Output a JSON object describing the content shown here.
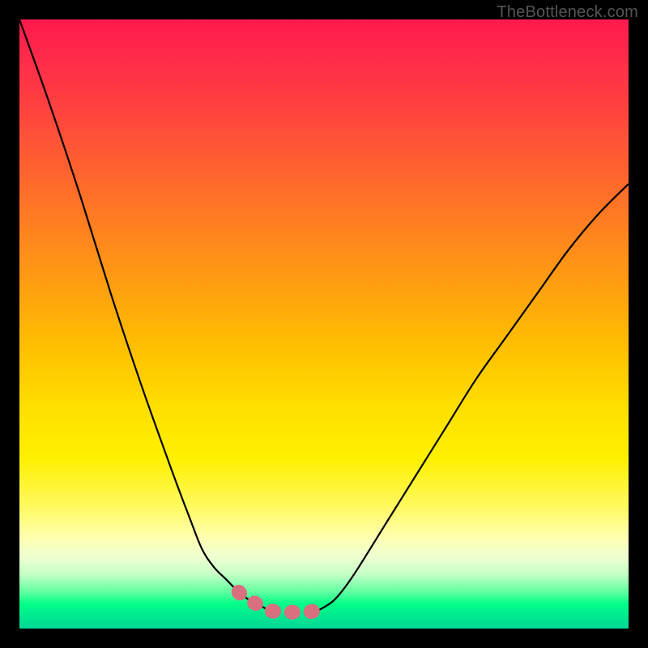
{
  "watermark": "TheBottleneck.com",
  "chart_data": {
    "type": "line",
    "title": "",
    "xlabel": "",
    "ylabel": "",
    "xlim": [
      0,
      100
    ],
    "ylim": [
      0,
      100
    ],
    "series": [
      {
        "name": "left-curve",
        "x": [
          0,
          5,
          10,
          15,
          20,
          25,
          28,
          30,
          32,
          34,
          36,
          38,
          40,
          41,
          42
        ],
        "y": [
          100,
          86,
          71,
          55,
          40,
          26,
          18,
          13,
          10,
          8,
          6,
          4.5,
          3.5,
          3,
          2.8
        ]
      },
      {
        "name": "right-curve",
        "x": [
          48,
          49,
          50,
          52,
          55,
          60,
          65,
          70,
          75,
          80,
          85,
          90,
          95,
          100
        ],
        "y": [
          2.8,
          3,
          3.5,
          5,
          9,
          17,
          25,
          33,
          41,
          48,
          55,
          62,
          68,
          73
        ]
      },
      {
        "name": "valley-marker",
        "x": [
          36,
          37,
          38,
          39,
          40,
          41,
          42,
          43,
          44,
          45,
          46,
          47,
          48,
          49,
          50
        ],
        "y": [
          6,
          5,
          4.5,
          4,
          3.5,
          3,
          2.8,
          2.7,
          2.7,
          2.7,
          2.7,
          2.7,
          2.8,
          3,
          3.5
        ]
      }
    ],
    "gradient_stops": [
      {
        "pos": 0,
        "color": "#ff1a4d"
      },
      {
        "pos": 50,
        "color": "#ffc000"
      },
      {
        "pos": 85,
        "color": "#ffffb0"
      },
      {
        "pos": 100,
        "color": "#00e890"
      }
    ]
  }
}
